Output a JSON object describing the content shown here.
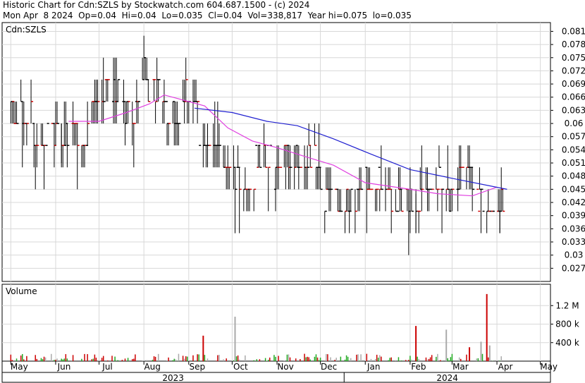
{
  "header": {
    "line1": "Historic Chart for Cdn:SZLS by Stockwatch.com 604.687.1500 - (c) 2024",
    "line2": "Mon Apr  8 2024  Op=0.04  Hi=0.04  Lo=0.035  Cl=0.04  Vol=338,817  Year hi=0.075  lo=0.035"
  },
  "colors": {
    "up": "#cc0000",
    "down": "#000000",
    "ma_short": "#e040e0",
    "ma_long": "#2020d0",
    "vol_up": "#22aa22",
    "vol_down": "#cc0000",
    "vol_flat": "#aaaaaa",
    "grid": "#d8d8d8"
  },
  "chart_data": [
    {
      "type": "line",
      "title": "Cdn:SZLS",
      "description": "daily high-low bars with moving averages",
      "xlabel": "",
      "ylabel": "",
      "ylim": [
        0.024,
        0.083
      ],
      "y_ticks": [
        "0.081",
        "0.078",
        "0.075",
        "0.072",
        "0.069",
        "0.066",
        "0.063",
        "0.06",
        "0.057",
        "0.054",
        "0.051",
        "0.048",
        "0.045",
        "0.042",
        "0.039",
        "0.036",
        "0.033",
        "0.03",
        "0.027"
      ],
      "x_ticks": [
        "May",
        "Jun",
        "Jul",
        "Aug",
        "Sep",
        "Oct",
        "Nov",
        "Dec",
        "Jan",
        "Feb",
        "Mar",
        "Apr",
        "May"
      ],
      "year_labels": [
        "2023",
        "2024"
      ],
      "grid": true,
      "price_series": [
        {
          "d": "2023-05-01",
          "c": 0.065
        },
        {
          "d": "2023-05-08",
          "c": 0.06
        },
        {
          "d": "2023-05-15",
          "c": 0.06
        },
        {
          "d": "2023-05-22",
          "c": 0.055
        },
        {
          "d": "2023-05-29",
          "c": 0.06
        },
        {
          "d": "2023-06-05",
          "c": 0.055
        },
        {
          "d": "2023-06-12",
          "c": 0.06
        },
        {
          "d": "2023-06-19",
          "c": 0.055
        },
        {
          "d": "2023-06-26",
          "c": 0.065
        },
        {
          "d": "2023-07-03",
          "c": 0.065
        },
        {
          "d": "2023-07-10",
          "c": 0.07
        },
        {
          "d": "2023-07-17",
          "c": 0.065
        },
        {
          "d": "2023-07-24",
          "c": 0.06
        },
        {
          "d": "2023-07-31",
          "c": 0.07
        },
        {
          "d": "2023-08-07",
          "c": 0.07
        },
        {
          "d": "2023-08-14",
          "c": 0.065
        },
        {
          "d": "2023-08-21",
          "c": 0.06
        },
        {
          "d": "2023-08-28",
          "c": 0.065
        },
        {
          "d": "2023-09-05",
          "c": 0.065
        },
        {
          "d": "2023-09-11",
          "c": 0.055
        },
        {
          "d": "2023-09-18",
          "c": 0.055
        },
        {
          "d": "2023-09-25",
          "c": 0.05
        },
        {
          "d": "2023-10-02",
          "c": 0.05
        },
        {
          "d": "2023-10-09",
          "c": 0.045
        },
        {
          "d": "2023-10-16",
          "c": 0.05
        },
        {
          "d": "2023-10-23",
          "c": 0.055
        },
        {
          "d": "2023-10-30",
          "c": 0.05
        },
        {
          "d": "2023-11-06",
          "c": 0.055
        },
        {
          "d": "2023-11-13",
          "c": 0.05
        },
        {
          "d": "2023-11-20",
          "c": 0.05
        },
        {
          "d": "2023-11-27",
          "c": 0.05
        },
        {
          "d": "2023-12-04",
          "c": 0.045
        },
        {
          "d": "2023-12-11",
          "c": 0.045
        },
        {
          "d": "2023-12-18",
          "c": 0.04
        },
        {
          "d": "2023-12-27",
          "c": 0.045
        },
        {
          "d": "2024-01-02",
          "c": 0.045
        },
        {
          "d": "2024-01-08",
          "c": 0.045
        },
        {
          "d": "2024-01-15",
          "c": 0.045
        },
        {
          "d": "2024-01-22",
          "c": 0.04
        },
        {
          "d": "2024-01-29",
          "c": 0.045
        },
        {
          "d": "2024-02-05",
          "c": 0.04
        },
        {
          "d": "2024-02-12",
          "c": 0.045
        },
        {
          "d": "2024-02-20",
          "c": 0.045
        },
        {
          "d": "2024-02-26",
          "c": 0.045
        },
        {
          "d": "2024-03-04",
          "c": 0.045
        },
        {
          "d": "2024-03-11",
          "c": 0.05
        },
        {
          "d": "2024-03-18",
          "c": 0.045
        },
        {
          "d": "2024-03-25",
          "c": 0.04
        },
        {
          "d": "2024-04-08",
          "c": 0.04
        }
      ],
      "ma_short": [
        {
          "d": "2023-06-10",
          "v": 0.0605
        },
        {
          "d": "2023-07-01",
          "v": 0.0605
        },
        {
          "d": "2023-07-20",
          "v": 0.0625
        },
        {
          "d": "2023-08-05",
          "v": 0.0645
        },
        {
          "d": "2023-08-15",
          "v": 0.0665
        },
        {
          "d": "2023-09-01",
          "v": 0.065
        },
        {
          "d": "2023-09-12",
          "v": 0.064
        },
        {
          "d": "2023-09-28",
          "v": 0.059
        },
        {
          "d": "2023-10-15",
          "v": 0.056
        },
        {
          "d": "2023-11-01",
          "v": 0.0545
        },
        {
          "d": "2023-11-20",
          "v": 0.0525
        },
        {
          "d": "2023-12-10",
          "v": 0.0505
        },
        {
          "d": "2024-01-01",
          "v": 0.0465
        },
        {
          "d": "2024-02-01",
          "v": 0.045
        },
        {
          "d": "2024-02-20",
          "v": 0.044
        },
        {
          "d": "2024-03-15",
          "v": 0.0435
        },
        {
          "d": "2024-04-01",
          "v": 0.0455
        }
      ],
      "ma_long": [
        {
          "d": "2023-09-05",
          "v": 0.0635
        },
        {
          "d": "2023-10-01",
          "v": 0.0625
        },
        {
          "d": "2023-10-25",
          "v": 0.0605
        },
        {
          "d": "2023-11-15",
          "v": 0.0595
        },
        {
          "d": "2023-12-10",
          "v": 0.0565
        },
        {
          "d": "2024-01-05",
          "v": 0.053
        },
        {
          "d": "2024-02-01",
          "v": 0.0495
        },
        {
          "d": "2024-03-01",
          "v": 0.0475
        },
        {
          "d": "2024-04-08",
          "v": 0.045
        }
      ]
    },
    {
      "type": "bar",
      "title": "Volume",
      "y_ticks": [
        "1.2 M",
        "800 k",
        "400 k"
      ],
      "ylim": [
        0,
        1600000
      ],
      "spikes": [
        {
          "d": "2023-09-11",
          "v": 550000
        },
        {
          "d": "2023-10-03",
          "v": 960000
        },
        {
          "d": "2024-02-05",
          "v": 760000
        },
        {
          "d": "2024-02-26",
          "v": 680000
        },
        {
          "d": "2024-03-25",
          "v": 1450000
        },
        {
          "d": "2024-03-21",
          "v": 420000
        },
        {
          "d": "2024-03-13",
          "v": 300000
        },
        {
          "d": "2024-03-27",
          "v": 338817
        }
      ]
    }
  ]
}
